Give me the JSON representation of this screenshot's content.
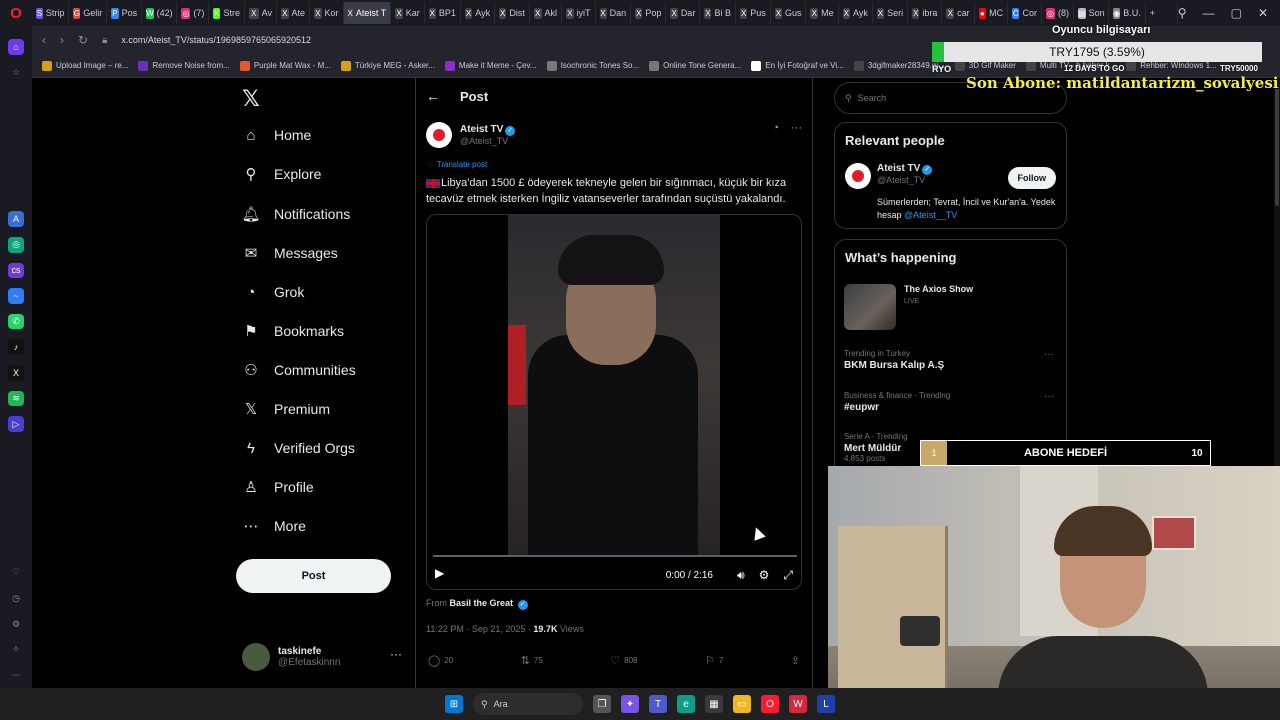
{
  "browser": {
    "tabs": [
      {
        "label": "Strip",
        "color": "#6b5bd6",
        "glyph": "S"
      },
      {
        "label": "Gelir",
        "color": "#e04c3c",
        "glyph": "G"
      },
      {
        "label": "Pos",
        "color": "#3b82f6",
        "glyph": "P"
      },
      {
        "label": "(42)",
        "color": "#22c55e",
        "glyph": "W"
      },
      {
        "label": "(7)",
        "color": "#e1306c",
        "glyph": "◎"
      },
      {
        "label": "Stre",
        "color": "#53fc18",
        "glyph": "K"
      },
      {
        "label": "Av",
        "color": "#444",
        "glyph": "X"
      },
      {
        "label": "Ate",
        "color": "#444",
        "glyph": "X"
      },
      {
        "label": "Kor",
        "color": "#444",
        "glyph": "X"
      },
      {
        "label": "Ateist T",
        "color": "#444",
        "glyph": "X",
        "active": true
      },
      {
        "label": "Kar",
        "color": "#444",
        "glyph": "X"
      },
      {
        "label": "BP1",
        "color": "#444",
        "glyph": "X"
      },
      {
        "label": "Ayk",
        "color": "#444",
        "glyph": "X"
      },
      {
        "label": "Dist",
        "color": "#444",
        "glyph": "X"
      },
      {
        "label": "Akl",
        "color": "#444",
        "glyph": "X"
      },
      {
        "label": "iyiT",
        "color": "#444",
        "glyph": "X"
      },
      {
        "label": "Dan",
        "color": "#444",
        "glyph": "X"
      },
      {
        "label": "Pop",
        "color": "#444",
        "glyph": "X"
      },
      {
        "label": "Dar",
        "color": "#444",
        "glyph": "X"
      },
      {
        "label": "Bi B",
        "color": "#444",
        "glyph": "X"
      },
      {
        "label": "Pus",
        "color": "#444",
        "glyph": "X"
      },
      {
        "label": "Gus",
        "color": "#444",
        "glyph": "X"
      },
      {
        "label": "Me",
        "color": "#444",
        "glyph": "X"
      },
      {
        "label": "Ayk",
        "color": "#444",
        "glyph": "X"
      },
      {
        "label": "Seri",
        "color": "#444",
        "glyph": "X"
      },
      {
        "label": "ibra",
        "color": "#444",
        "glyph": "X"
      },
      {
        "label": "car",
        "color": "#444",
        "glyph": "X"
      },
      {
        "label": "MC",
        "color": "#ff0000",
        "glyph": "●"
      },
      {
        "label": "Cor",
        "color": "#3b82f6",
        "glyph": "C"
      },
      {
        "label": "(8)",
        "color": "#e1306c",
        "glyph": "◎"
      },
      {
        "label": "Son",
        "color": "#bbb",
        "glyph": "▤"
      },
      {
        "label": "B.U.",
        "color": "#888",
        "glyph": "◉"
      }
    ],
    "url": "x.com/Ateist_TV/status/1969859765065920512",
    "bookmarks": [
      {
        "label": "Upload Image – re...",
        "color": "#d4a017"
      },
      {
        "label": "Remove Noise from...",
        "color": "#6b2fbf"
      },
      {
        "label": "Purple Mat Wax - M...",
        "color": "#e05a2b"
      },
      {
        "label": "Türkiye MEG - Asker...",
        "color": "#d4a017"
      },
      {
        "label": "Make it Meme - Çev...",
        "color": "#8b2fc9"
      },
      {
        "label": "Isochronic Tones So...",
        "color": "#777"
      },
      {
        "label": "Online Tone Genera...",
        "color": "#777"
      },
      {
        "label": "En İyi Fotoğraf ve Vi...",
        "color": "#fff"
      },
      {
        "label": "3dgifmaker28349.gi...",
        "color": "#444"
      },
      {
        "label": "3D Gif Maker",
        "color": "#444"
      },
      {
        "label": "Multi TV - b haber k...",
        "color": "#444"
      },
      {
        "label": "Rehber: Windows 1...",
        "color": "#444"
      }
    ]
  },
  "nav": {
    "items": [
      {
        "label": "Home",
        "icon": "⌂",
        "name": "home"
      },
      {
        "label": "Explore",
        "icon": "⚲",
        "name": "explore"
      },
      {
        "label": "Notifications",
        "icon": "🔔︎",
        "name": "notifications"
      },
      {
        "label": "Messages",
        "icon": "✉",
        "name": "messages"
      },
      {
        "label": "Grok",
        "icon": "◔",
        "name": "grok"
      },
      {
        "label": "Bookmarks",
        "icon": "⚑",
        "name": "bookmarks"
      },
      {
        "label": "Communities",
        "icon": "⚇",
        "name": "communities"
      },
      {
        "label": "Premium",
        "icon": "𝕏",
        "name": "premium"
      },
      {
        "label": "Verified Orgs",
        "icon": "ϟ",
        "name": "verified-orgs"
      },
      {
        "label": "Profile",
        "icon": "♙",
        "name": "profile"
      },
      {
        "label": "More",
        "icon": "⋯",
        "name": "more"
      }
    ],
    "post_button": "Post",
    "account": {
      "name": "taskinefe",
      "handle": "@Efetaskinnn"
    }
  },
  "post": {
    "header_title": "Post",
    "author_name": "Ateist TV",
    "author_handle": "@Ateist_TV",
    "translate": "Translate post",
    "text": "Libya'dan 1500 £ ödeyerek tekneyle gelen bir sığınmacı, küçük bir kıza tecavüz etmek isterken İngiliz vatanseverler tarafından suçüstü yakalandı.",
    "video_time": "0:00 / 2:16",
    "video_progress": 0,
    "from_prefix": "From",
    "from_name": "Basil the Great",
    "timestamp": "11:22 PM · Sep 21, 2025 ·",
    "views_count": "19.7K",
    "views_label": "Views",
    "replies": "20",
    "reposts": "75",
    "likes": "808",
    "bookmarks": "7"
  },
  "sidebar": {
    "search_placeholder": "Search",
    "relevant_title": "Relevant people",
    "rp_name": "Ateist TV",
    "rp_handle": "@Ateist_TV",
    "follow": "Follow",
    "rp_bio": "Sümerlerden; Tevrat, İncil ve Kur'an'a. Yedek hesap",
    "rp_bio_link": "@Ateist__TV",
    "happening_title": "What’s happening",
    "axios_title": "The Axios Show",
    "axios_live": "LIVE",
    "trends": [
      {
        "category": "Trending in Turkey",
        "name": "BKM Bursa Kalıp A.Ş"
      },
      {
        "category": "Business & finance · Trending",
        "name": "#eupwr"
      },
      {
        "category": "Serie A · Trending",
        "name": "Mert Müldür"
      }
    ],
    "trend_posts": "4,853 posts"
  },
  "overlay": {
    "donate_title": "Oyuncu bilgisayarı",
    "donate_text": "TRY1795 (3.59%)",
    "donate_progress": 0.0359,
    "donate_left": "RYO",
    "donate_mid": "12 DAYS TO GO",
    "donate_right": "TRY50000",
    "sub_text": "Son Abone: matildantarizm_sovalyesi",
    "goal_count": "1",
    "goal_label": "ABONE HEDEFİ",
    "goal_target": "10"
  },
  "taskbar": {
    "search_placeholder": "Ara"
  },
  "colors": {
    "accent": "#1d9bf0",
    "donate_fill": "#25c23b",
    "sub_text": "#f6ee3a"
  }
}
